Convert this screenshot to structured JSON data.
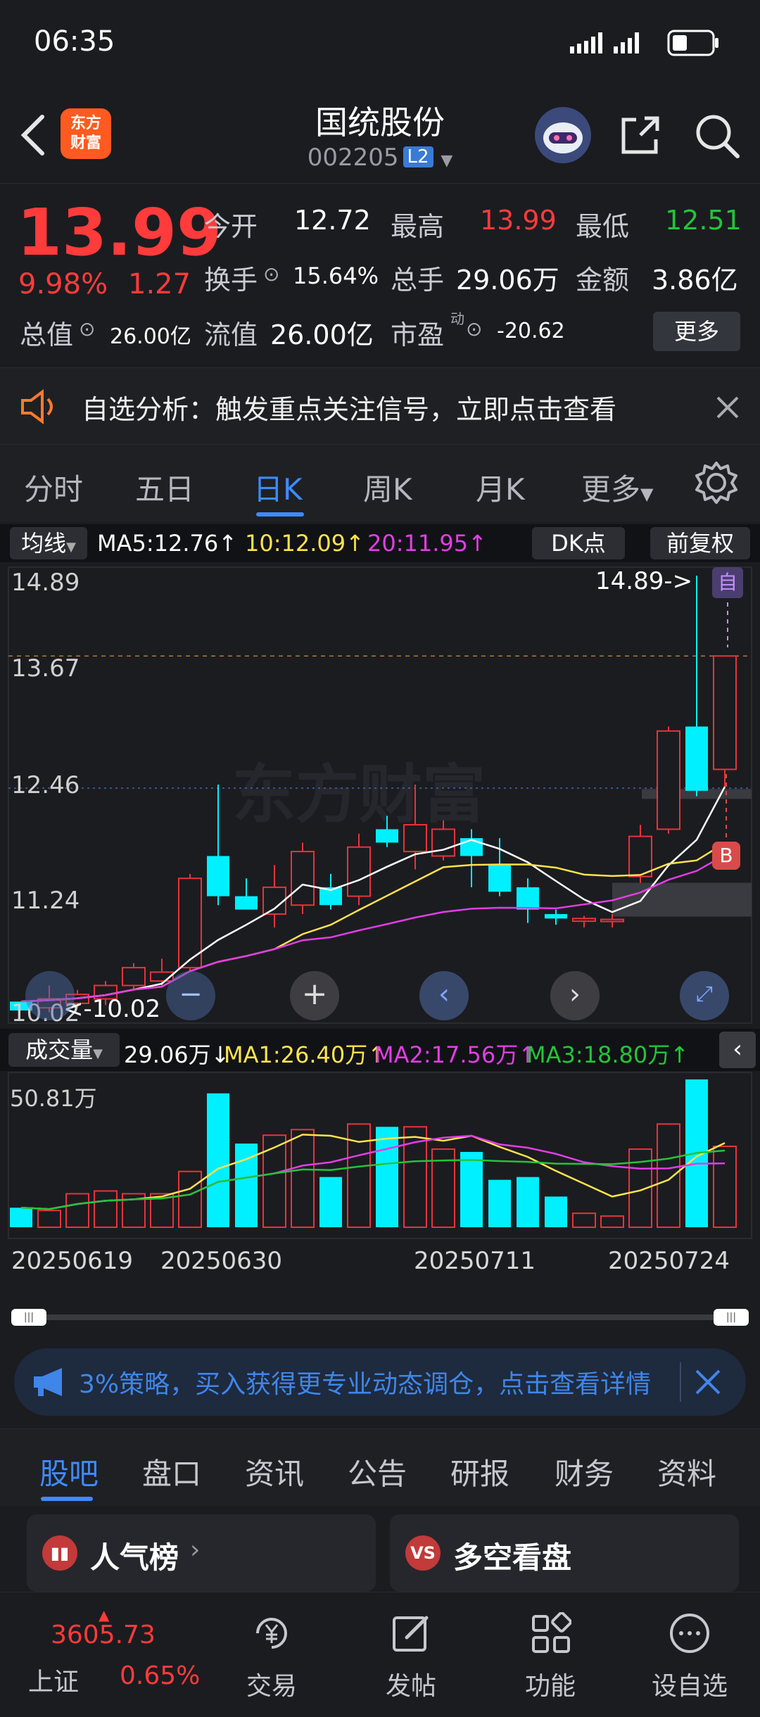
{
  "status": {
    "time": "06:35"
  },
  "header": {
    "title": "国统股份",
    "code": "002205",
    "level": "L2",
    "logo_line1": "东方",
    "logo_line2": "财富"
  },
  "quote": {
    "price": "13.99",
    "pct": "9.98%",
    "change": "1.27",
    "open_label": "今开",
    "open": "12.72",
    "high_label": "最高",
    "high": "13.99",
    "low_label": "最低",
    "low": "12.51",
    "turnover_label": "换手",
    "turnover": "15.64%",
    "volume_label": "总手",
    "volume": "29.06万",
    "amount_label": "金额",
    "amount": "3.86亿",
    "mktcap_label": "总值",
    "mktcap": "26.00亿",
    "float_label": "流值",
    "float": "26.00亿",
    "pe_label": "市盈",
    "pe_sup": "动",
    "pe": "-20.62",
    "more": "更多"
  },
  "notice": {
    "text": "自选分析：触发重点关注信号，立即点击查看"
  },
  "tabs": [
    "分时",
    "五日",
    "日K",
    "周K",
    "月K",
    "更多"
  ],
  "ma": {
    "label": "均线",
    "ma5": "MA5:12.76↑",
    "ma10": "10:12.09↑",
    "ma20": "20:11.95↑",
    "dk": "DK点",
    "adj": "前复权"
  },
  "chart_labels": {
    "p1": "14.89",
    "p2": "13.67",
    "p3": "12.46",
    "p4": "11.24",
    "p5": "10.02",
    "max_note": "14.89->",
    "min_note": "<-10.02",
    "self_tag": "自",
    "buy_tag": "B"
  },
  "vol": {
    "label": "成交量",
    "value": "29.06万↓",
    "ma1": "MA1:26.40万↑",
    "ma2": "MA2:17.56万↑",
    "ma3": "MA3:18.80万↑",
    "max": "50.81万"
  },
  "dates": [
    "20250619",
    "20250630",
    "20250711",
    "20250724"
  ],
  "banner": {
    "text": "3%策略，买入获得更专业动态调仓，点击查看详情"
  },
  "subtabs": [
    "股吧",
    "盘口",
    "资讯",
    "公告",
    "研报",
    "财务",
    "资料"
  ],
  "cards": {
    "left": "人气榜",
    "right": "多空看盘",
    "right_icon": "VS"
  },
  "bottom": {
    "index_value": "3605.73",
    "index_name": "上证",
    "index_pct": "0.65%",
    "items": [
      "交易",
      "发帖",
      "功能",
      "设自选"
    ]
  },
  "chart_data": {
    "type": "candlestick",
    "y_range": [
      10.02,
      14.89
    ],
    "candles": [
      {
        "o": 10.02,
        "h": 10.12,
        "l": 10.02,
        "c": 10.12,
        "up": false
      },
      {
        "o": 10.05,
        "h": 10.3,
        "l": 10.0,
        "c": 10.15,
        "up": true
      },
      {
        "o": 10.1,
        "h": 10.25,
        "l": 10.05,
        "c": 10.2,
        "up": true
      },
      {
        "o": 10.15,
        "h": 10.35,
        "l": 10.08,
        "c": 10.3,
        "up": true
      },
      {
        "o": 10.3,
        "h": 10.55,
        "l": 10.25,
        "c": 10.5,
        "up": true
      },
      {
        "o": 10.35,
        "h": 10.6,
        "l": 10.3,
        "c": 10.45,
        "up": true
      },
      {
        "o": 10.5,
        "h": 11.55,
        "l": 10.45,
        "c": 11.5,
        "up": true
      },
      {
        "o": 11.75,
        "h": 12.55,
        "l": 11.2,
        "c": 11.3,
        "up": false
      },
      {
        "o": 11.3,
        "h": 11.5,
        "l": 11.15,
        "c": 11.15,
        "up": false
      },
      {
        "o": 11.1,
        "h": 11.65,
        "l": 10.95,
        "c": 11.4,
        "up": true
      },
      {
        "o": 11.2,
        "h": 11.9,
        "l": 11.1,
        "c": 11.8,
        "up": true
      },
      {
        "o": 11.4,
        "h": 11.55,
        "l": 11.15,
        "c": 11.2,
        "up": false
      },
      {
        "o": 11.3,
        "h": 12.0,
        "l": 11.2,
        "c": 11.85,
        "up": true
      },
      {
        "o": 12.05,
        "h": 12.2,
        "l": 11.85,
        "c": 11.9,
        "up": false
      },
      {
        "o": 11.8,
        "h": 12.55,
        "l": 11.6,
        "c": 12.1,
        "up": true
      },
      {
        "o": 11.75,
        "h": 12.15,
        "l": 11.7,
        "c": 12.05,
        "up": true
      },
      {
        "o": 11.95,
        "h": 12.05,
        "l": 11.4,
        "c": 11.75,
        "up": false
      },
      {
        "o": 11.65,
        "h": 11.95,
        "l": 11.3,
        "c": 11.35,
        "up": false
      },
      {
        "o": 11.4,
        "h": 11.5,
        "l": 11.0,
        "c": 11.15,
        "up": false
      },
      {
        "o": 11.1,
        "h": 11.15,
        "l": 10.98,
        "c": 11.05,
        "up": false
      },
      {
        "o": 11.05,
        "h": 11.08,
        "l": 10.95,
        "c": 11.02,
        "up": true
      },
      {
        "o": 11.02,
        "h": 11.1,
        "l": 10.95,
        "c": 11.04,
        "up": true
      },
      {
        "o": 11.52,
        "h": 12.1,
        "l": 11.45,
        "c": 11.97,
        "up": true
      },
      {
        "o": 12.05,
        "h": 13.2,
        "l": 12.0,
        "c": 13.15,
        "up": true
      },
      {
        "o": 13.2,
        "h": 14.89,
        "l": 12.42,
        "c": 12.48,
        "up": false
      },
      {
        "o": 12.72,
        "h": 13.99,
        "l": 12.51,
        "c": 13.99,
        "up": true
      }
    ],
    "volumes": [
      7,
      6,
      12,
      13,
      12,
      12,
      20,
      48,
      30,
      33,
      35,
      18,
      37,
      36,
      36,
      28,
      27,
      17,
      18,
      11,
      5,
      4,
      28,
      37,
      53,
      29
    ]
  }
}
